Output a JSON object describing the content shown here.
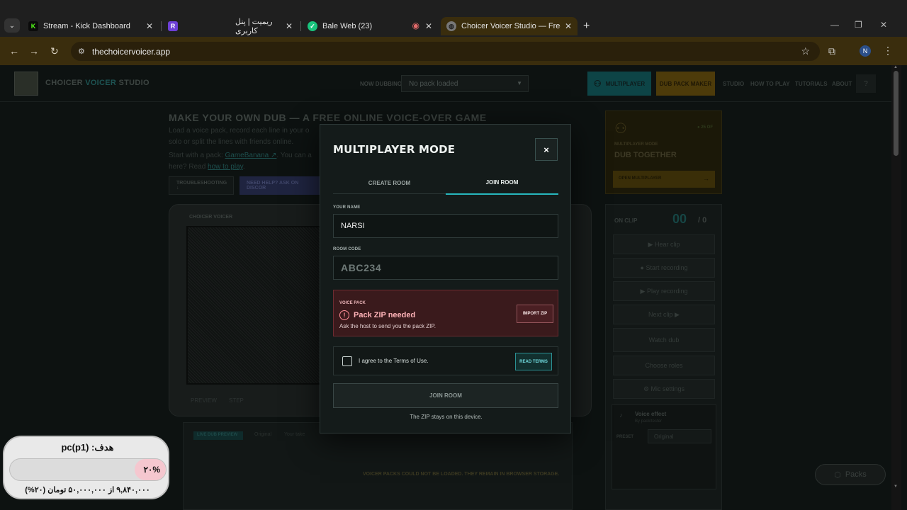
{
  "browser": {
    "tabs": [
      {
        "title": "Stream - Kick Dashboard",
        "favicon": "kick-icon",
        "color": "#53fc18",
        "glyph": "K"
      },
      {
        "title": "ریمیت | پنل کاربری",
        "favicon": "remit-icon",
        "color": "#7c3aed",
        "glyph": "R"
      },
      {
        "title": "Bale Web (23)",
        "favicon": "bale-icon",
        "color": "#19c37d",
        "glyph": "✓"
      },
      {
        "title": "",
        "favicon": "recording-icon",
        "color": "#e26a6a",
        "glyph": "◉"
      },
      {
        "title": "Choicer Voicer Studio — Free O",
        "favicon": "globe-icon",
        "color": "#888888",
        "glyph": "◍"
      }
    ],
    "new_tab": "+",
    "url": "thechoicervoicer.app",
    "profile_initial": "N"
  },
  "site": {
    "logo_text_pre": "CHOICER ",
    "logo_text_hl": "VOICER",
    "logo_text_post": " STUDIO",
    "now_dubbing_label": "NOW DUBBING",
    "pack_select_value": "No pack loaded",
    "multiplayer_btn": "MULTIPLAYER",
    "dub_pack_maker_btn": "DUB PACK MAKER",
    "nav": [
      "STUDIO",
      "HOW TO PLAY",
      "TUTORIALS",
      "ABOUT"
    ],
    "help_q": "?",
    "hero_title": "MAKE YOUR OWN DUB — A FREE ONLINE VOICE-OVER GAME",
    "hero_lines": [
      "Load a voice pack, record each line in your o",
      "solo or split the lines with friends online."
    ],
    "hero_start": "Start with a pack: ",
    "hero_start_link": "GameBanana ↗",
    "hero_start_rest": ". You can a",
    "hero_here": "here? Read ",
    "hero_here_link": "how to play",
    "hero_here_end": ".",
    "troubleshooting": "TROUBLESHOOTING ↓",
    "need_help": "NEED HELP? ASK ON DISCOR",
    "tv_label": "CHOICER VOICER",
    "tv_ctrl": [
      "PREVIEW",
      "STEP"
    ],
    "lower_tag": "LIVE DUB PREVIEW",
    "lower_opts": [
      "Original",
      "Your take"
    ],
    "footer_note": "VOICER PACKS COULD NOT BE LOADED. THEY REMAIN IN BROWSER STORAGE.",
    "side_card": {
      "mode_label": "MULTIPLAYER MODE",
      "online": "● 25 OF",
      "title": "DUB TOGETHER",
      "button": "OPEN MULTIPLAYER"
    },
    "side_panel": {
      "on_clip": "ON CLIP",
      "clip_num": "00",
      "clip_total": "/ 0",
      "buttons": [
        "▶ Hear clip",
        "● Start recording",
        "▶ Play recording",
        "Next clip ▶",
        "Watch dub",
        "Choose roles",
        "⚙ Mic settings"
      ],
      "voice_effect": "Voice effect",
      "voice_sub": "By pack/tester",
      "preset_label": "PRESET",
      "preset_value": "Original"
    },
    "packs_btn": "Packs"
  },
  "modal": {
    "title": "MULTIPLAYER MODE",
    "close": "×",
    "tab_create": "CREATE ROOM",
    "tab_join": "JOIN ROOM",
    "name_label": "YOUR NAME",
    "name_value": "NARSI",
    "code_label": "ROOM CODE",
    "code_placeholder": "ABC234",
    "voice_pack_label": "VOICE PACK",
    "voice_pack_title": "Pack ZIP needed",
    "voice_pack_sub": "Ask the host to send you the pack ZIP.",
    "import_zip": "IMPORT ZIP",
    "terms_label": "I agree to the Terms of Use.",
    "read_terms": "READ TERMS",
    "join_btn": "JOIN ROOM",
    "zip_note": "The ZIP stays on this device."
  },
  "goal_widget": {
    "title": "هدف: pc(p1)",
    "percent_label": "۲۰%",
    "progress_fraction": 0.2,
    "amount": "۹,۸۴۰,۰۰۰ از ۵۰,۰۰۰,۰۰۰ تومان (۲۰%)"
  }
}
